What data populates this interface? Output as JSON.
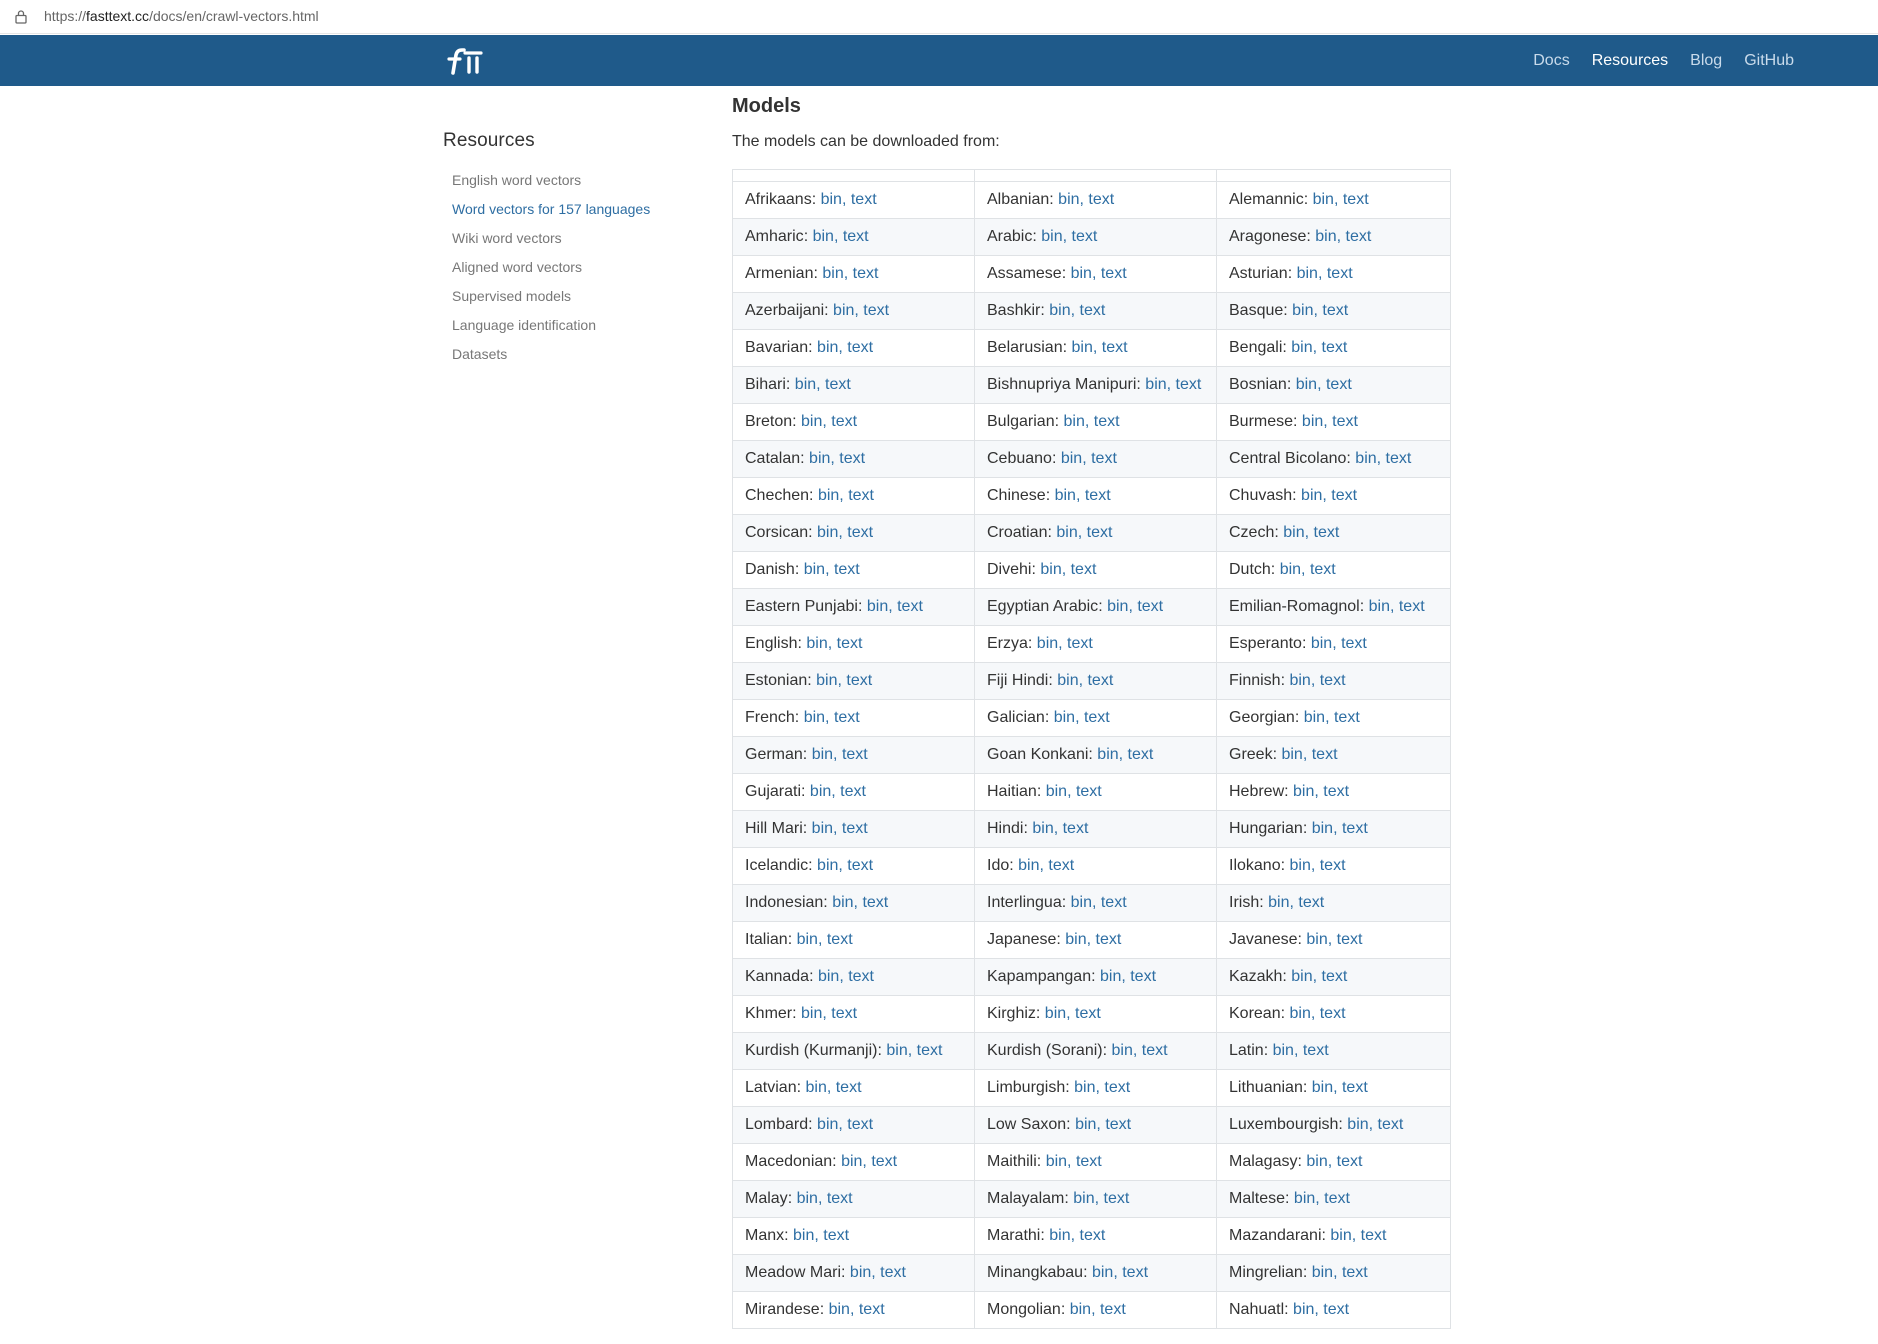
{
  "browser": {
    "url_prefix": "https://",
    "url_host": "fasttext.cc",
    "url_path": "/docs/en/crawl-vectors.html",
    "lock_icon": "lock-icon"
  },
  "header": {
    "logo_icon": "fasttext-logo",
    "nav": [
      {
        "label": "Docs",
        "active": false
      },
      {
        "label": "Resources",
        "active": true
      },
      {
        "label": "Blog",
        "active": false
      },
      {
        "label": "GitHub",
        "active": false
      }
    ],
    "colors": {
      "navbar": "#1f5a8a",
      "link": "#2e6ea3"
    }
  },
  "sidebar": {
    "title": "Resources",
    "items": [
      {
        "label": "English word vectors",
        "active": false
      },
      {
        "label": "Word vectors for 157 languages",
        "active": true
      },
      {
        "label": "Wiki word vectors",
        "active": false
      },
      {
        "label": "Aligned word vectors",
        "active": false
      },
      {
        "label": "Supervised models",
        "active": false
      },
      {
        "label": "Language identification",
        "active": false
      },
      {
        "label": "Datasets",
        "active": false
      }
    ]
  },
  "main": {
    "heading": "Models",
    "intro": "The models can be downloaded from:",
    "link_bin": "bin",
    "link_sep": ", ",
    "link_text": "text",
    "rows": [
      [
        "Afrikaans",
        "Albanian",
        "Alemannic"
      ],
      [
        "Amharic",
        "Arabic",
        "Aragonese"
      ],
      [
        "Armenian",
        "Assamese",
        "Asturian"
      ],
      [
        "Azerbaijani",
        "Bashkir",
        "Basque"
      ],
      [
        "Bavarian",
        "Belarusian",
        "Bengali"
      ],
      [
        "Bihari",
        "Bishnupriya Manipuri",
        "Bosnian"
      ],
      [
        "Breton",
        "Bulgarian",
        "Burmese"
      ],
      [
        "Catalan",
        "Cebuano",
        "Central Bicolano"
      ],
      [
        "Chechen",
        "Chinese",
        "Chuvash"
      ],
      [
        "Corsican",
        "Croatian",
        "Czech"
      ],
      [
        "Danish",
        "Divehi",
        "Dutch"
      ],
      [
        "Eastern Punjabi",
        "Egyptian Arabic",
        "Emilian-Romagnol"
      ],
      [
        "English",
        "Erzya",
        "Esperanto"
      ],
      [
        "Estonian",
        "Fiji Hindi",
        "Finnish"
      ],
      [
        "French",
        "Galician",
        "Georgian"
      ],
      [
        "German",
        "Goan Konkani",
        "Greek"
      ],
      [
        "Gujarati",
        "Haitian",
        "Hebrew"
      ],
      [
        "Hill Mari",
        "Hindi",
        "Hungarian"
      ],
      [
        "Icelandic",
        "Ido",
        "Ilokano"
      ],
      [
        "Indonesian",
        "Interlingua",
        "Irish"
      ],
      [
        "Italian",
        "Japanese",
        "Javanese"
      ],
      [
        "Kannada",
        "Kapampangan",
        "Kazakh"
      ],
      [
        "Khmer",
        "Kirghiz",
        "Korean"
      ],
      [
        "Kurdish (Kurmanji)",
        "Kurdish (Sorani)",
        "Latin"
      ],
      [
        "Latvian",
        "Limburgish",
        "Lithuanian"
      ],
      [
        "Lombard",
        "Low Saxon",
        "Luxembourgish"
      ],
      [
        "Macedonian",
        "Maithili",
        "Malagasy"
      ],
      [
        "Malay",
        "Malayalam",
        "Maltese"
      ],
      [
        "Manx",
        "Marathi",
        "Mazandarani"
      ],
      [
        "Meadow Mari",
        "Minangkabau",
        "Mingrelian"
      ],
      [
        "Mirandese",
        "Mongolian",
        "Nahuatl"
      ]
    ]
  }
}
